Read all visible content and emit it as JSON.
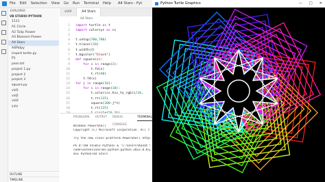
{
  "vscode": {
    "menu": [
      "File",
      "Edit",
      "Selection",
      "View",
      "Go",
      "Run",
      "Terminal",
      "Help"
    ],
    "window_title": "A4 Stars - Pyt"
  },
  "explorer": {
    "heading": "EXPLORER",
    "section": "VB STUDIO PYTHON",
    "files": [
      "1111",
      "A1 Circle",
      "A2 Tulip Flower",
      "A3 Blossom Flower",
      "A4 Stars",
      "A4Patpy",
      "import turtle.py",
      "P1",
      "pass.txt",
      "project 1.py",
      "project 2",
      "project 3",
      "square.py",
      "vid1",
      "vid2",
      "vid3",
      "y.py"
    ],
    "selected": "A4 Stars",
    "outline": "OUTLINE",
    "timeline": "TIMELINE"
  },
  "editor": {
    "tabs": [
      "vid4",
      "A4 Stars"
    ],
    "active_tab": "A4 Stars",
    "breadcrumb": "A4 Stars",
    "line_numbers": [
      "1",
      "2",
      "3",
      "4",
      "5",
      "6",
      "7",
      "8",
      "9",
      "10",
      "11",
      "12",
      "13",
      "14",
      "15",
      "16",
      "17",
      "18",
      "19"
    ],
    "code_lines": [
      "import turtle as t",
      "import colorsys as cs",
      "",
      "t.setup(700,700)",
      "t.tracer(10)",
      "t.width(4)",
      "t.bgcolor(\"black\")",
      "def square(x):",
      "    for i in range(3):",
      "        t.fd(x)",
      "        t.rt(90)",
      "    t.fd(x)",
      "for j in range(10):",
      "    for i in range(10):",
      "        t.color(cs.hsv_to_rgb(i/10,",
      "        t.rt(135)",
      "        square(200-j*4)",
      "        t.rt(135)",
      "        t.circle(50,36)"
    ]
  },
  "panel": {
    "tabs": [
      "PROBLEMS",
      "OUTPUT",
      "DEBUG CONSOLE",
      "TERMINAL"
    ],
    "active_tab": "TERMINAL",
    "terminal_lines": [
      "Windows PowerShell",
      "Copyright (C) Microsoft Corporation. All rights reserved.",
      "",
      "Try the new cross-platform PowerShell https://aka.ms/pscore6",
      "",
      "PS D:\\VB Studio Python>  & 'C:\\Users\\Kanat S",
      "code\\extensions\\ms-python.python-2023.8.0\\py",
      "dio Python\\A4 Stars"
    ]
  },
  "turtle_window": {
    "title": "Python Turtle Graphics",
    "controls": [
      "—",
      "□",
      "✕"
    ]
  },
  "icons": {
    "vscode_logo": "vscode-logo-icon",
    "turtle_icon": "turtle-feather-icon"
  },
  "colors": {
    "accent": "#1a85d6",
    "canvas_bg": "#000000"
  }
}
